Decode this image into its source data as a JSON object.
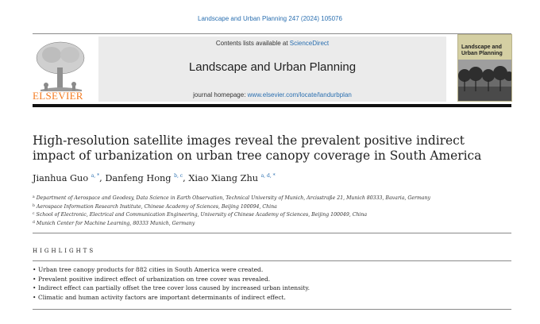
{
  "citation": "Landscape and Urban Planning 247 (2024) 105076",
  "banner": {
    "contents_prefix": "Contents lists available at ",
    "contents_link": "ScienceDirect",
    "journal_title": "Landscape and Urban Planning",
    "homepage_prefix": "journal homepage: ",
    "homepage_link": "www.elsevier.com/locate/landurbplan"
  },
  "publisher": "ELSEVIER",
  "cover": {
    "title": "Landscape and Urban Planning"
  },
  "article": {
    "title": "High-resolution satellite images reveal the prevalent positive indirect impact of urbanization on urban tree canopy coverage in South America",
    "authors": [
      {
        "name": "Jianhua Guo",
        "sup": "a, *"
      },
      {
        "name": "Danfeng Hong",
        "sup": "b, c"
      },
      {
        "name": "Xiao Xiang Zhu",
        "sup": "a, d, *"
      }
    ],
    "separator": ", ",
    "affiliations": [
      {
        "mark": "a",
        "text": "Department of Aerospace and Geodesy, Data Science in Earth Observation, Technical University of Munich, Arcisstraße 21, Munich 80333, Bavaria, Germany"
      },
      {
        "mark": "b",
        "text": "Aerospace Information Research Institute, Chinese Academy of Sciences, Beijing 100094, China"
      },
      {
        "mark": "c",
        "text": "School of Electronic, Electrical and Communication Engineering, University of Chinese Academy of Sciences, Beijing 100049, China"
      },
      {
        "mark": "d",
        "text": "Munich Center for Machine Learning, 80333 Munich, Germany"
      }
    ]
  },
  "highlights": {
    "heading": "HIGHLIGHTS",
    "bullet": "•",
    "items": [
      "Urban tree canopy products for 882 cities in South America were created.",
      "Prevalent positive indirect effect of urbanization on tree cover was revealed.",
      "Indirect effect can partially offset the tree cover loss caused by increased urban intensity.",
      "Climatic and human activity factors are important determinants of indirect effect."
    ]
  },
  "colors": {
    "link": "#2a6fb0",
    "elsevier_orange": "#f47b20",
    "banner_bg": "#ebebeb",
    "cover_bg": "#d4cfa3"
  }
}
